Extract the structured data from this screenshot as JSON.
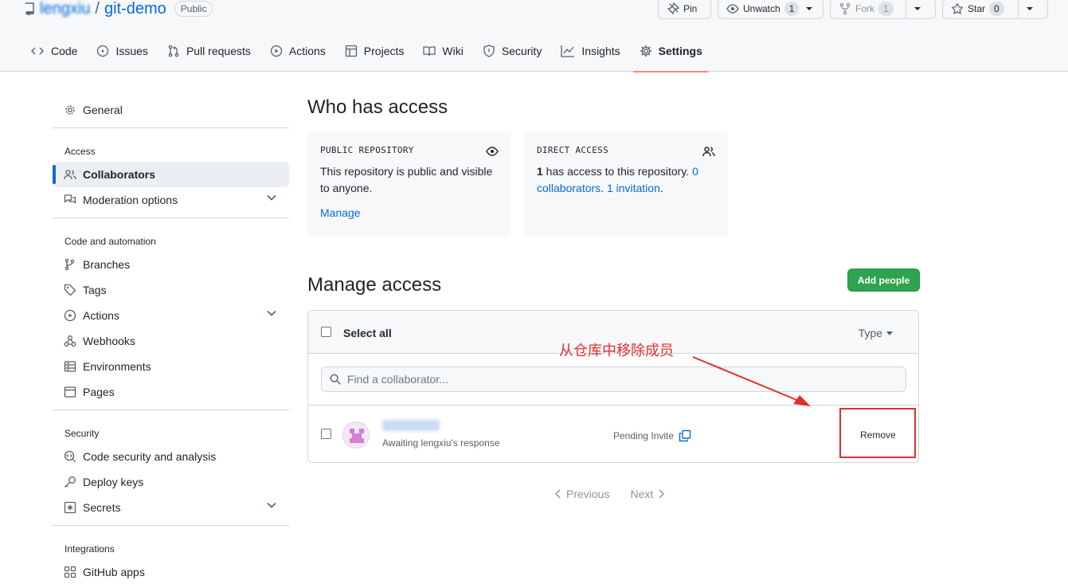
{
  "repo": {
    "owner": "lengxiu",
    "name": "git-demo",
    "visibility": "Public"
  },
  "top_buttons": {
    "pin": "Pin",
    "unwatch": "Unwatch",
    "unwatch_count": "1",
    "fork": "Fork",
    "fork_count": "1",
    "star": "Star",
    "star_count": "0"
  },
  "tabs": [
    {
      "label": "Code",
      "icon": "code-icon"
    },
    {
      "label": "Issues",
      "icon": "issue-icon"
    },
    {
      "label": "Pull requests",
      "icon": "pull-request-icon"
    },
    {
      "label": "Actions",
      "icon": "play-icon"
    },
    {
      "label": "Projects",
      "icon": "table-icon"
    },
    {
      "label": "Wiki",
      "icon": "book-icon"
    },
    {
      "label": "Security",
      "icon": "shield-icon"
    },
    {
      "label": "Insights",
      "icon": "graph-icon"
    },
    {
      "label": "Settings",
      "icon": "gear-icon",
      "selected": true
    }
  ],
  "sidebar": {
    "general": "General",
    "access_heading": "Access",
    "collaborators": "Collaborators",
    "moderation": "Moderation options",
    "code_heading": "Code and automation",
    "branches": "Branches",
    "tags": "Tags",
    "actions": "Actions",
    "webhooks": "Webhooks",
    "environments": "Environments",
    "pages": "Pages",
    "security_heading": "Security",
    "code_security": "Code security and analysis",
    "deploy_keys": "Deploy keys",
    "secrets": "Secrets",
    "integrations_heading": "Integrations",
    "github_apps": "GitHub apps"
  },
  "who_has_access": {
    "title": "Who has access",
    "public_card": {
      "label": "PUBLIC REPOSITORY",
      "text": "This repository is public and visible to anyone.",
      "link": "Manage"
    },
    "direct_card": {
      "label": "DIRECT ACCESS",
      "count": "1",
      "text_mid": " has access to this repository. ",
      "collaborators_link": "0 collaborators",
      "sep": ". ",
      "invitation_link": "1 invitation",
      "end": "."
    }
  },
  "manage_access": {
    "title": "Manage access",
    "add_button": "Add people",
    "select_all": "Select all",
    "type_filter": "Type",
    "search_placeholder": "Find a collaborator...",
    "rows": [
      {
        "username": "lengxiu",
        "status": "Awaiting lengxiu's response",
        "state": "Pending Invite",
        "action": "Remove"
      }
    ]
  },
  "pagination": {
    "previous": "Previous",
    "next": "Next"
  },
  "annotation": {
    "text": "从仓库中移除成员",
    "color": "#e0302c"
  }
}
